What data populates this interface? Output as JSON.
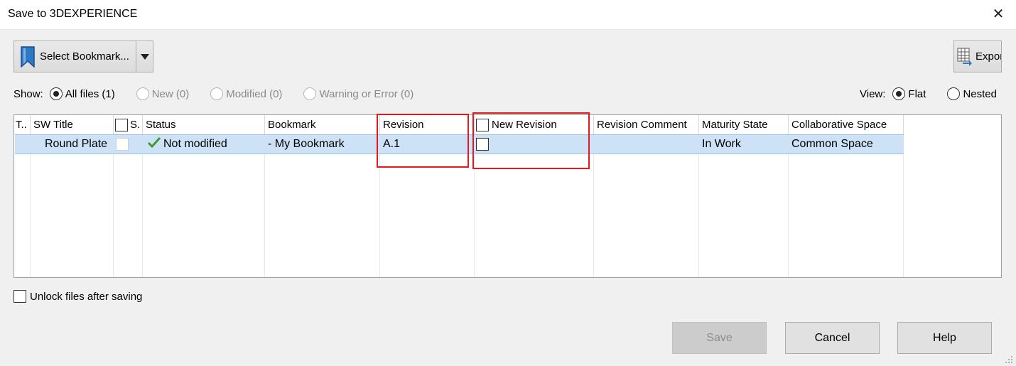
{
  "window": {
    "title": "Save to 3DEXPERIENCE"
  },
  "toolbar": {
    "bookmark_label": "Select Bookmark...",
    "export_label": "Export"
  },
  "show": {
    "label": "Show:",
    "options": [
      {
        "label": "All files (1)",
        "checked": true,
        "disabled": false
      },
      {
        "label": "New (0)",
        "checked": false,
        "disabled": true
      },
      {
        "label": "Modified (0)",
        "checked": false,
        "disabled": true
      },
      {
        "label": "Warning or Error (0)",
        "checked": false,
        "disabled": true
      }
    ]
  },
  "view": {
    "label": "View:",
    "options": [
      {
        "label": "Flat",
        "checked": true
      },
      {
        "label": "Nested",
        "checked": false
      }
    ]
  },
  "table": {
    "columns": [
      "T..",
      "SW Title",
      "S.",
      "Status",
      "Bookmark",
      "Revision",
      "New Revision",
      "Revision Comment",
      "Maturity State",
      "Collaborative Space"
    ],
    "rows": [
      {
        "title": "Round Plate",
        "status": "Not modified",
        "bookmark": "- My Bookmark",
        "revision": "A.1",
        "revision_comment": "",
        "maturity_state": "In Work",
        "collab_space": "Common Space"
      }
    ]
  },
  "options": {
    "unlock_label": "Unlock files after saving"
  },
  "buttons": {
    "save": "Save",
    "cancel": "Cancel",
    "help": "Help"
  },
  "colors": {
    "selected_row": "#cde2f7",
    "highlight_box": "#e01a22",
    "check_green": "#3b9b2f"
  }
}
